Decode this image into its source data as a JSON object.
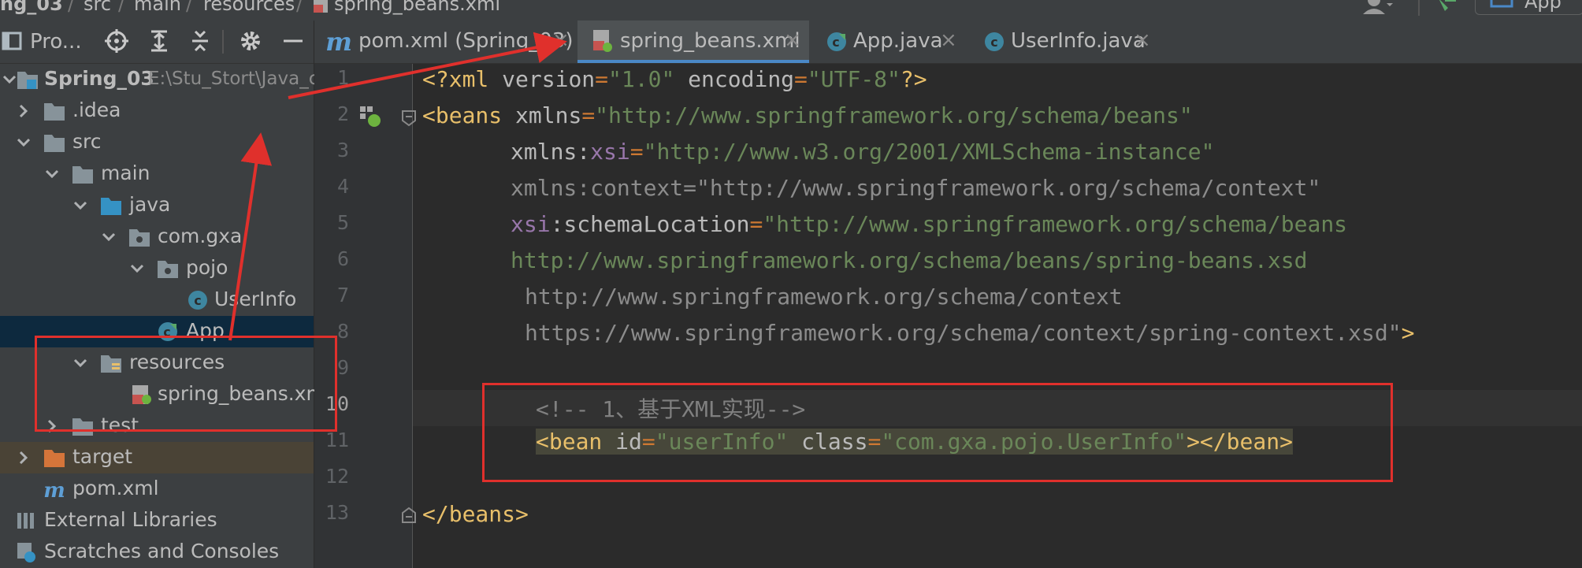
{
  "breadcrumb": {
    "project": "ng_03",
    "items": [
      "src",
      "main",
      "resources",
      "spring_beans.xml"
    ],
    "run_config": "App"
  },
  "project_panel": {
    "title": "Pro...",
    "tree": [
      {
        "label": "Spring_03",
        "path": "E:\\Stu_Stort\\Java_c"
      },
      {
        "label": ".idea"
      },
      {
        "label": "src"
      },
      {
        "label": "main"
      },
      {
        "label": "java"
      },
      {
        "label": "com.gxa"
      },
      {
        "label": "pojo"
      },
      {
        "label": "UserInfo"
      },
      {
        "label": "App"
      },
      {
        "label": "resources"
      },
      {
        "label": "spring_beans.xml"
      },
      {
        "label": "test"
      },
      {
        "label": "target"
      },
      {
        "label": "pom.xml"
      },
      {
        "label": "External Libraries"
      },
      {
        "label": "Scratches and Consoles"
      }
    ]
  },
  "tabs": [
    {
      "label": "pom.xml (Spring_03)"
    },
    {
      "label": "spring_beans.xml"
    },
    {
      "label": "App.java"
    },
    {
      "label": "UserInfo.java"
    }
  ],
  "close_glyph": "×",
  "editor": {
    "line_numbers": [
      "1",
      "2",
      "3",
      "4",
      "5",
      "6",
      "7",
      "8",
      "9",
      "10",
      "11",
      "12",
      "13"
    ],
    "l1": {
      "open": "<?",
      "tag": "xml",
      "a1": " version",
      "eq1": "=",
      "v1": "\"1.0\"",
      "a2": " encoding",
      "eq2": "=",
      "v2": "\"UTF-8\"",
      "close": "?>"
    },
    "l2": {
      "open": "<",
      "tag": "beans",
      "a": " xmlns",
      "eq": "=",
      "v": "\"http://www.springframework.org/schema/beans\""
    },
    "l3": {
      "a": "xmlns",
      "colon": ":",
      "ns": "xsi",
      "eq": "=",
      "v": "\"http://www.w3.org/2001/XMLSchema-instance\""
    },
    "l4": {
      "text": "xmlns:context=\"http://www.springframework.org/schema/context\""
    },
    "l5": {
      "ns": "xsi",
      "a": ":schemaLocation",
      "eq": "=",
      "v": "\"http://www.springframework.org/schema/beans"
    },
    "l6": {
      "v": "http://www.springframework.org/schema/beans/spring-beans.xsd"
    },
    "l7": {
      "text": "http://www.springframework.org/schema/context"
    },
    "l8": {
      "text": "https://www.springframework.org/schema/context/spring-context.xsd\"",
      "close": ">"
    },
    "l10": {
      "comment": "<!-- 1、基于XML实现-->"
    },
    "l11": {
      "open": "<",
      "tag": "bean",
      "a1": " id",
      "eq1": "=",
      "v1": "\"userInfo\"",
      "a2": " class",
      "eq2": "=",
      "v2": "\"com.gxa.pojo.UserInfo\"",
      "close": "></bean>"
    },
    "l13": {
      "close": "</beans>"
    }
  },
  "colors": {
    "annotation": "#e0302c",
    "tab_active_underline": "#4a88c7",
    "xml_tag": "#e8bf6a",
    "xml_value": "#6a8759",
    "xml_namespace": "#9876aa"
  }
}
